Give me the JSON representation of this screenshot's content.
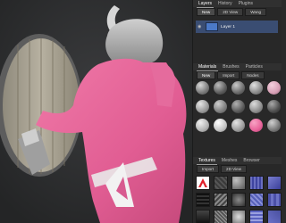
{
  "layers_panel": {
    "tabs": [
      "Layers",
      "History",
      "Plugins"
    ],
    "buttons": [
      "New",
      "2D View",
      "Wang"
    ],
    "layer_name": "Layer 1"
  },
  "materials_panel": {
    "tabs": [
      "Materials",
      "Brushes",
      "Particles"
    ],
    "buttons": [
      "New",
      "Import",
      "Nodes"
    ]
  },
  "textures_panel": {
    "tabs": [
      "Textures",
      "Meshes",
      "Browser"
    ],
    "buttons": [
      "Import",
      "2D View"
    ]
  },
  "colors": {
    "accent_pink": "#e8639a",
    "layer_highlight": "#3a4d72",
    "panel_bg": "#282828"
  }
}
